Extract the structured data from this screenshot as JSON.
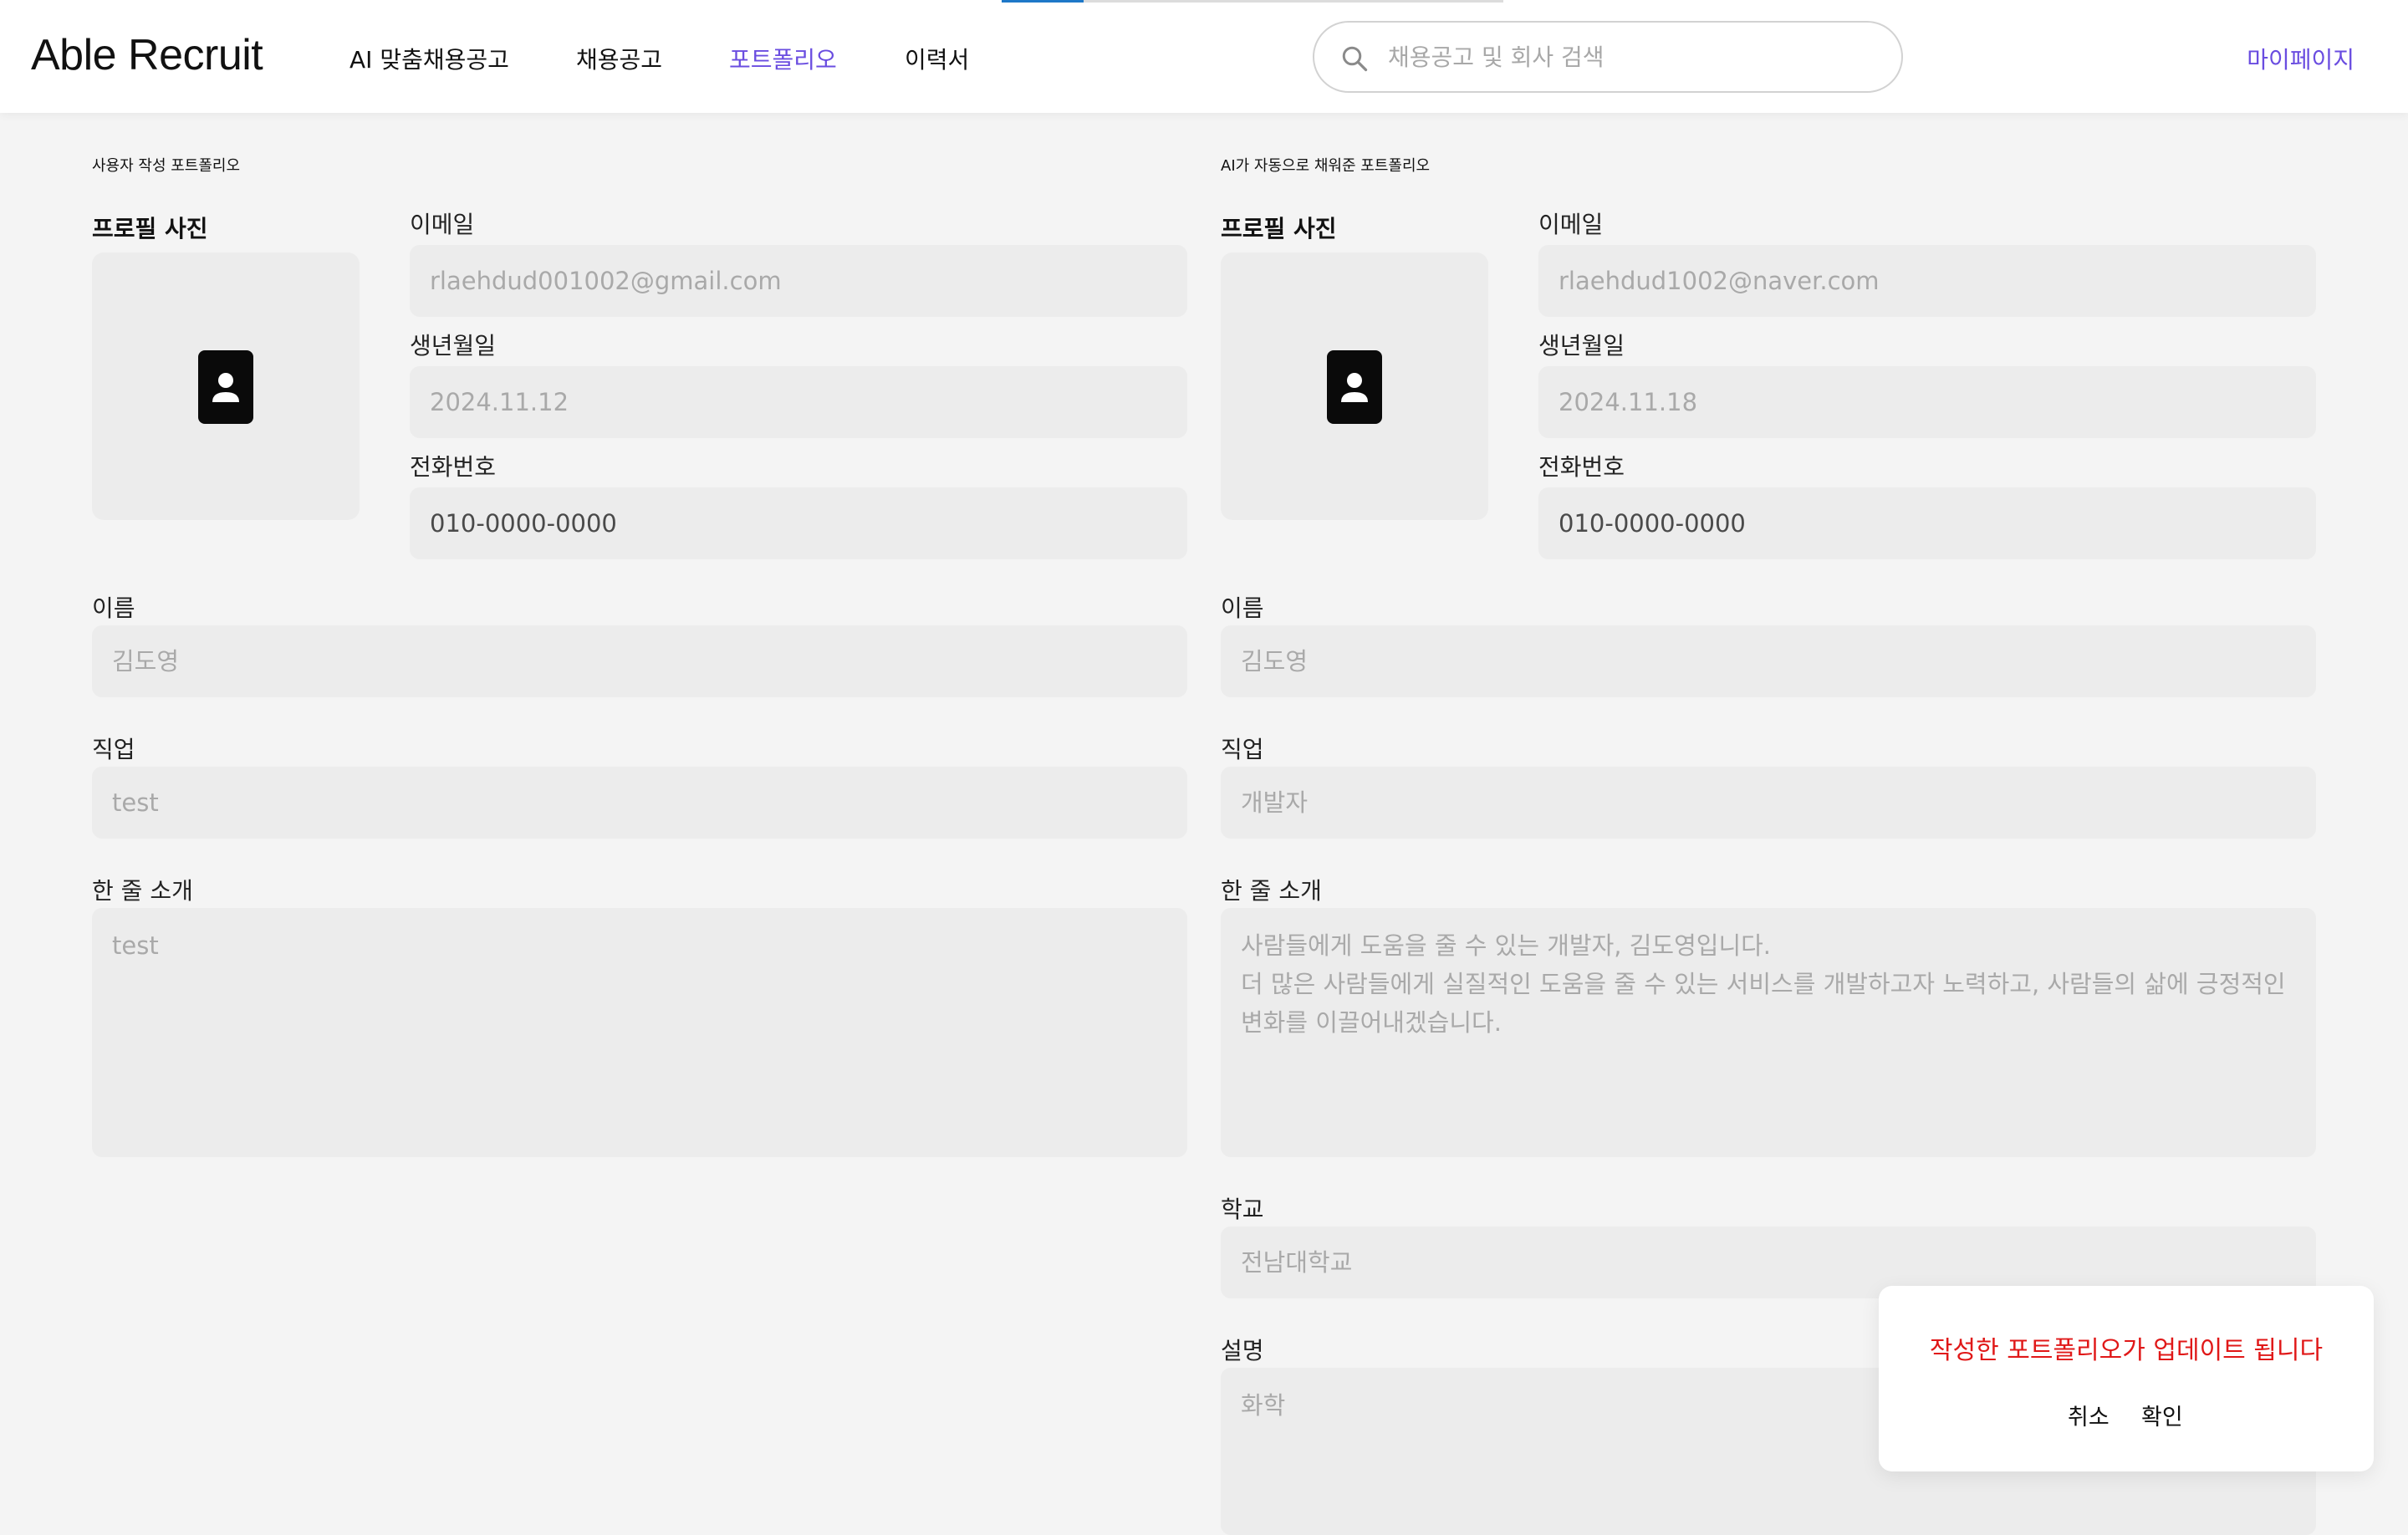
{
  "header": {
    "logo": "Able Recruit",
    "nav": [
      {
        "label": "AI 맞춤채용공고",
        "active": false
      },
      {
        "label": "채용공고",
        "active": false
      },
      {
        "label": "포트폴리오",
        "active": true
      },
      {
        "label": "이력서",
        "active": false
      }
    ],
    "search": {
      "placeholder": "채용공고 및 회사 검색",
      "value": ""
    },
    "mypage": "마이페이지"
  },
  "user_portfolio": {
    "title": "사용자 작성 포트폴리오",
    "photo_label": "프로필 사진",
    "email_label": "이메일",
    "email": "rlaehdud001002@gmail.com",
    "birth_label": "생년월일",
    "birth": "2024.11.12",
    "phone_label": "전화번호",
    "phone": "010-0000-0000",
    "name_label": "이름",
    "name": "김도영",
    "job_label": "직업",
    "job": "test",
    "intro_label": "한 줄 소개",
    "intro": "test"
  },
  "ai_portfolio": {
    "title": "AI가 자동으로 채워준 포트폴리오",
    "photo_label": "프로필 사진",
    "email_label": "이메일",
    "email": "rlaehdud1002@naver.com",
    "birth_label": "생년월일",
    "birth": "2024.11.18",
    "phone_label": "전화번호",
    "phone": "010-0000-0000",
    "name_label": "이름",
    "name": "김도영",
    "job_label": "직업",
    "job": "개발자",
    "intro_label": "한 줄 소개",
    "intro": "사람들에게 도움을 줄 수 있는 개발자, 김도영입니다.\n더 많은 사람들에게 실질적인 도움을 줄 수 있는 서비스를 개발하고자 노력하고, 사람들의 삶에 긍정적인 변화를 이끌어내겠습니다.",
    "school_label": "학교",
    "school": "전남대학교",
    "desc_label": "설명",
    "desc": "화학"
  },
  "dialog": {
    "message": "작성한 포트폴리오가 업데이트 됩니다",
    "cancel": "취소",
    "confirm": "확인"
  },
  "colors": {
    "accent": "#6a4de0",
    "warning": "#e01818",
    "field_bg": "#ececec",
    "page_bg": "#f4f4f4"
  }
}
